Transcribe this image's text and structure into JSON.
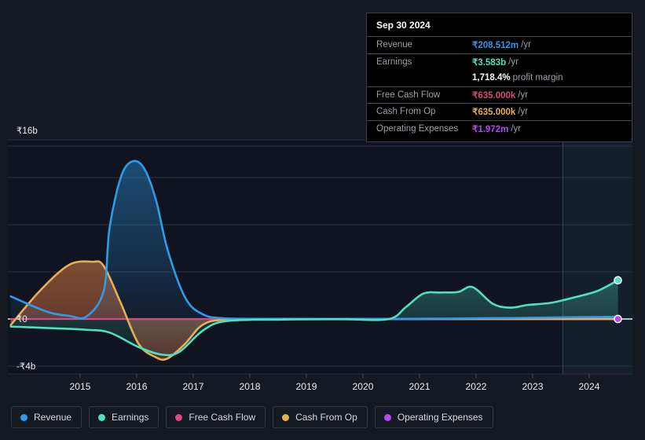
{
  "chart_data": {
    "type": "area",
    "title": "",
    "xlabel": "",
    "ylabel": "",
    "currency_symbol": "₹",
    "grid": true,
    "legend_position": "bottom",
    "xlim": [
      2014.25,
      2025.0
    ],
    "ylim": [
      -4000000000,
      16000000000
    ],
    "y_ticks": [
      {
        "label": "₹16b",
        "value": 16000000000
      },
      {
        "label": "₹0",
        "value": 0
      },
      {
        "label": "-₹4b",
        "value": -4000000000
      }
    ],
    "x_ticks": [
      "2015",
      "2016",
      "2017",
      "2018",
      "2019",
      "2020",
      "2021",
      "2022",
      "2023",
      "2024"
    ],
    "forecast_start": "2023.8",
    "series": [
      {
        "name": "Revenue",
        "color": "#2e9be8",
        "x": [
          2014.3,
          2014.7,
          2015.0,
          2015.3,
          2015.6,
          2015.9,
          2016.0,
          2016.2,
          2016.4,
          2016.6,
          2016.8,
          2017.0,
          2017.3,
          2017.6,
          2018.0,
          2019.0,
          2020.0,
          2021.0,
          2022.0,
          2023.0,
          2023.6,
          2024.0,
          2024.4,
          2024.75
        ],
        "values": [
          2.1,
          1.15,
          0.55,
          0.3,
          0.22,
          2.6,
          8.4,
          13.2,
          14.6,
          13.9,
          11.0,
          6.4,
          2.0,
          0.45,
          0.06,
          0.02,
          0.01,
          0.01,
          0.05,
          0.1,
          0.14,
          0.17,
          0.19,
          0.2085
        ],
        "unit": "b"
      },
      {
        "name": "Earnings",
        "color": "#4fe0c4",
        "x": [
          2014.3,
          2015.0,
          2015.6,
          2016.0,
          2016.5,
          2016.9,
          2017.2,
          2017.6,
          2018.0,
          2019.0,
          2020.0,
          2020.8,
          2021.1,
          2021.4,
          2021.7,
          2022.0,
          2022.25,
          2022.6,
          2022.9,
          2023.2,
          2023.6,
          2024.0,
          2024.4,
          2024.75
        ],
        "values": [
          -0.7,
          -0.85,
          -1.0,
          -1.25,
          -2.6,
          -3.3,
          -3.05,
          -1.1,
          -0.2,
          -0.05,
          -0.02,
          -0.01,
          1.1,
          2.35,
          2.45,
          2.5,
          2.95,
          1.4,
          1.05,
          1.3,
          1.5,
          2.0,
          2.6,
          3.583
        ],
        "unit": "b"
      },
      {
        "name": "Free Cash Flow",
        "color": "#d84a7e",
        "x": [
          2014.3,
          2017.0,
          2020.0,
          2024.75
        ],
        "values": [
          0.0,
          0.0,
          0.0,
          0.000635
        ],
        "unit": "b"
      },
      {
        "name": "Cash From Op",
        "color": "#e8ae53",
        "x": [
          2014.3,
          2014.8,
          2015.3,
          2015.7,
          2015.9,
          2016.2,
          2016.5,
          2016.8,
          2017.0,
          2017.3,
          2017.6,
          2018.0,
          2019.0,
          2020.0,
          2022.0,
          2024.75
        ],
        "values": [
          -0.55,
          2.6,
          5.0,
          5.3,
          4.9,
          1.4,
          -2.3,
          -3.55,
          -3.65,
          -2.3,
          -0.55,
          -0.05,
          0.0,
          0.0,
          0.0,
          0.000635
        ],
        "unit": "b"
      },
      {
        "name": "Operating Expenses",
        "color": "#b44bf0",
        "x": [
          2019.7,
          2021.0,
          2022.0,
          2023.0,
          2024.0,
          2024.75
        ],
        "values": [
          0.0,
          0.0,
          0.0,
          0.0,
          0.001,
          0.001972
        ],
        "unit": "b"
      }
    ]
  },
  "tooltip": {
    "date": "Sep 30 2024",
    "rows": [
      {
        "label": "Revenue",
        "value": "₹208.512m",
        "unit": "/yr",
        "color": "#2e9be8",
        "divider": true
      },
      {
        "label": "Earnings",
        "value": "₹3.583b",
        "unit": "/yr",
        "color": "#4fe0c4",
        "divider": true
      },
      {
        "label": "",
        "value": "1,718.4%",
        "unit": "profit margin",
        "color": "#ffffff",
        "divider": false
      },
      {
        "label": "Free Cash Flow",
        "value": "₹635.000k",
        "unit": "/yr",
        "color": "#d84a7e",
        "divider": true
      },
      {
        "label": "Cash From Op",
        "value": "₹635.000k",
        "unit": "/yr",
        "color": "#e8ae53",
        "divider": true
      },
      {
        "label": "Operating Expenses",
        "value": "₹1.972m",
        "unit": "/yr",
        "color": "#b44bf0",
        "divider": true
      }
    ]
  },
  "legend": {
    "items": [
      {
        "label": "Revenue",
        "color": "#2e9be8"
      },
      {
        "label": "Earnings",
        "color": "#4fe0c4"
      },
      {
        "label": "Free Cash Flow",
        "color": "#d84a7e"
      },
      {
        "label": "Cash From Op",
        "color": "#e8ae53"
      },
      {
        "label": "Operating Expenses",
        "color": "#b44bf0"
      }
    ]
  },
  "colors": {
    "background": "#151922",
    "plot_background": "#101420",
    "forecast_background": "#152330",
    "gridline": "#2b303b",
    "zero_line": "#ffffff",
    "negative_fill": "#4a1d26"
  }
}
